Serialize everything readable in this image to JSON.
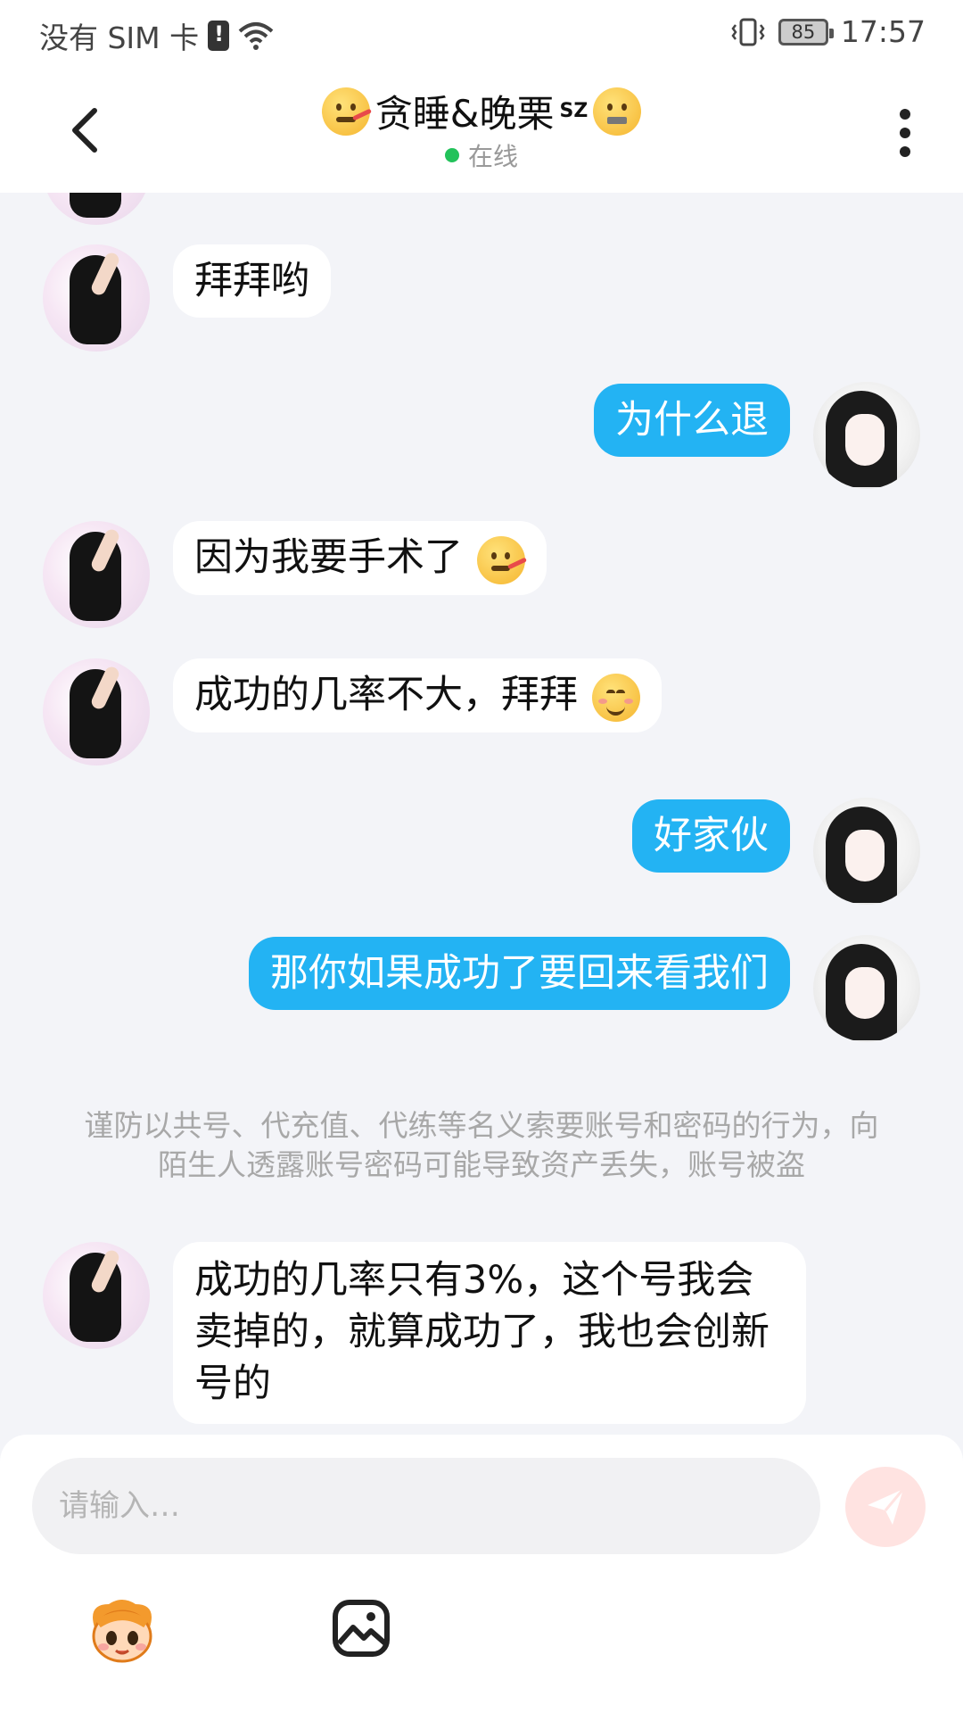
{
  "status_bar": {
    "carrier": "没有 SIM 卡",
    "battery": "85",
    "time": "17:57"
  },
  "header": {
    "title": "贪睡&晚栗",
    "title_sup": "SZ",
    "status": "在线"
  },
  "messages": [
    {
      "side": "in",
      "text": "拜拜哟"
    },
    {
      "side": "out",
      "text": "为什么退"
    },
    {
      "side": "in",
      "text": "因为我要手术了",
      "emoji": "sick-face"
    },
    {
      "side": "in",
      "text": "成功的几率不大，拜拜",
      "emoji": "smiling-face"
    },
    {
      "side": "out",
      "text": "好家伙"
    },
    {
      "side": "out",
      "text": "那你如果成功了要回来看我们"
    },
    {
      "side": "in",
      "text": "成功的几率只有3%，这个号我会卖掉的，就算成功了，我也会创新号的"
    }
  ],
  "notice": "谨防以共号、代充值、代练等名义索要账号和密码的行为，向陌生人透露账号密码可能导致资产丢失，账号被盗",
  "input": {
    "placeholder": "请输入…",
    "value": ""
  },
  "colors": {
    "outgoing_bubble": "#23b3f3",
    "incoming_bubble": "#ffffff",
    "background": "#f3f4f8",
    "online": "#22c25a",
    "send_button": "#ffe3e1"
  },
  "icons": [
    "back-icon",
    "more-icon",
    "send-icon",
    "emoji-mascot-icon",
    "image-icon"
  ]
}
